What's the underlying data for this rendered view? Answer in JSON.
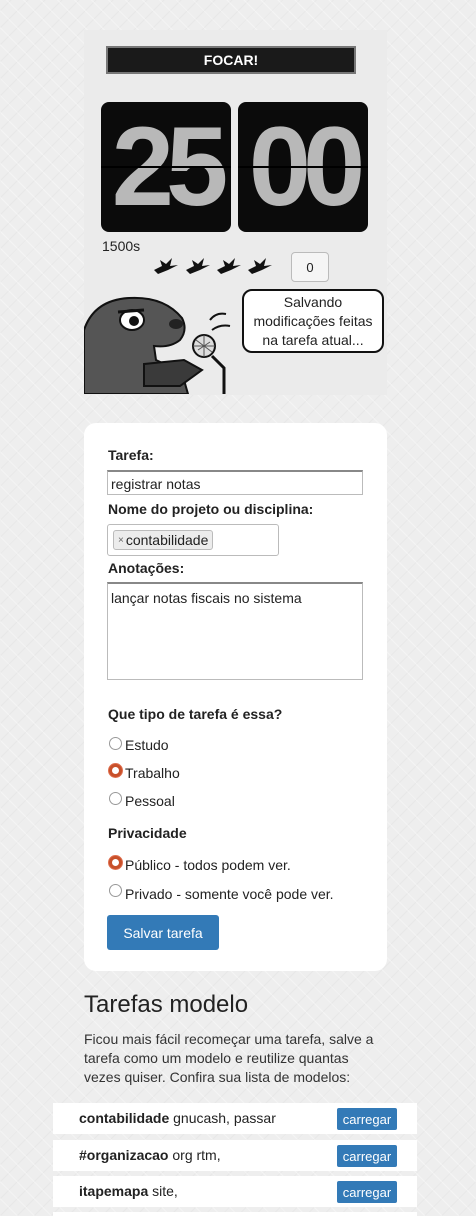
{
  "timer": {
    "focus_button": "FOCAR!",
    "minutes": "25",
    "seconds": "00",
    "seconds_label": "1500s",
    "count": "0",
    "mascot_message": "Salvando modificações feitas na tarefa atual..."
  },
  "form": {
    "task_label": "Tarefa:",
    "task_value": "registrar notas",
    "project_label": "Nome do projeto ou disciplina:",
    "project_tag": "contabilidade",
    "project_tag_remove": "×",
    "notes_label": "Anotações:",
    "notes_value": "lançar notas fiscais no sistema",
    "type_question": "Que tipo de tarefa é essa?",
    "type_options": [
      {
        "label": "Estudo",
        "selected": false
      },
      {
        "label": "Trabalho",
        "selected": true
      },
      {
        "label": "Pessoal",
        "selected": false
      }
    ],
    "privacy_label": "Privacidade",
    "privacy_options": [
      {
        "label": "Público - todos podem ver.",
        "selected": true
      },
      {
        "label": "Privado - somente você pode ver.",
        "selected": false
      }
    ],
    "save_button": "Salvar tarefa"
  },
  "templates": {
    "title": "Tarefas modelo",
    "description": "Ficou mais fácil recomeçar uma tarefa, salve a tarefa como um modelo e reutilize quantas vezes quiser. Confira sua lista de modelos:",
    "items": [
      {
        "name": "contabilidade",
        "tags": " gnucash, passar",
        "button": "carregar"
      },
      {
        "name": "#organizacao",
        "tags": " org rtm,",
        "button": "carregar"
      },
      {
        "name": "itapemapa",
        "tags": " site,",
        "button": "carregar"
      }
    ]
  },
  "colors": {
    "accent": "#337ab7",
    "radio_selected": "#c8502a",
    "flip_bg": "#0b0b0b"
  }
}
